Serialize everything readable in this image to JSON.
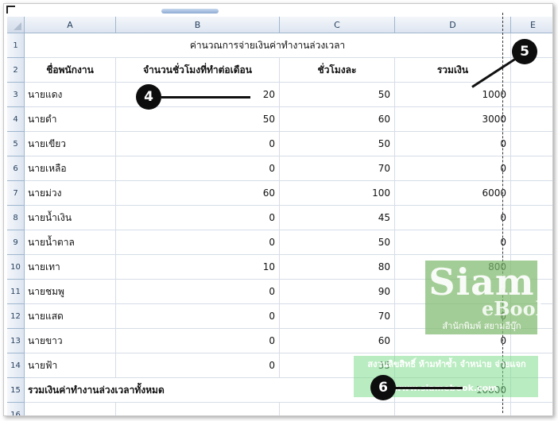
{
  "columns": [
    "A",
    "B",
    "C",
    "D",
    "E"
  ],
  "row_numbers": [
    "1",
    "2",
    "3",
    "4",
    "5",
    "6",
    "7",
    "8",
    "9",
    "10",
    "11",
    "12",
    "13",
    "14",
    "15",
    "16"
  ],
  "title": "ค่านวณการจ่ายเงินค่าทำงานล่วงเวลา",
  "headers": {
    "name": "ชื่อพนักงาน",
    "hours": "จำนวนชั่วโมงที่ทำต่อเดือน",
    "rate": "ชั่วโมงละ",
    "total": "รวมเงิน"
  },
  "rows": [
    {
      "name": "นายแดง",
      "hours": "20",
      "rate": "50",
      "total": "1000"
    },
    {
      "name": "นายดำ",
      "hours": "50",
      "rate": "60",
      "total": "3000"
    },
    {
      "name": "นายเขียว",
      "hours": "0",
      "rate": "50",
      "total": "0"
    },
    {
      "name": "นายเหลือ",
      "hours": "0",
      "rate": "70",
      "total": "0"
    },
    {
      "name": "นายม่วง",
      "hours": "60",
      "rate": "100",
      "total": "6000"
    },
    {
      "name": "นายน้ำเงิน",
      "hours": "0",
      "rate": "45",
      "total": "0"
    },
    {
      "name": "นายน้ำตาล",
      "hours": "0",
      "rate": "50",
      "total": "0"
    },
    {
      "name": "นายเทา",
      "hours": "10",
      "rate": "80",
      "total": "800"
    },
    {
      "name": "นายชมพู",
      "hours": "0",
      "rate": "90",
      "total": "0"
    },
    {
      "name": "นายแสด",
      "hours": "0",
      "rate": "70",
      "total": "0"
    },
    {
      "name": "นายขาว",
      "hours": "0",
      "rate": "60",
      "total": "0"
    },
    {
      "name": "นายฟ้า",
      "hours": "0",
      "rate": "35",
      "total": "0"
    }
  ],
  "summary": {
    "label": "รวมเงินค่าทำงานล่วงเวลาทั้งหมด",
    "total": "10800"
  },
  "markers": [
    "4",
    "5",
    "6"
  ],
  "watermark": {
    "title": "Siam",
    "subtitle": "eBook",
    "tagline": "สำนักพิมพ์ สยามอีบุ๊ก",
    "copyright": "สงวนลิขสิทธิ์ ห้ามทำซ้ำ จำหน่าย จ่ายแจก",
    "url": "www.siamebook.com"
  }
}
